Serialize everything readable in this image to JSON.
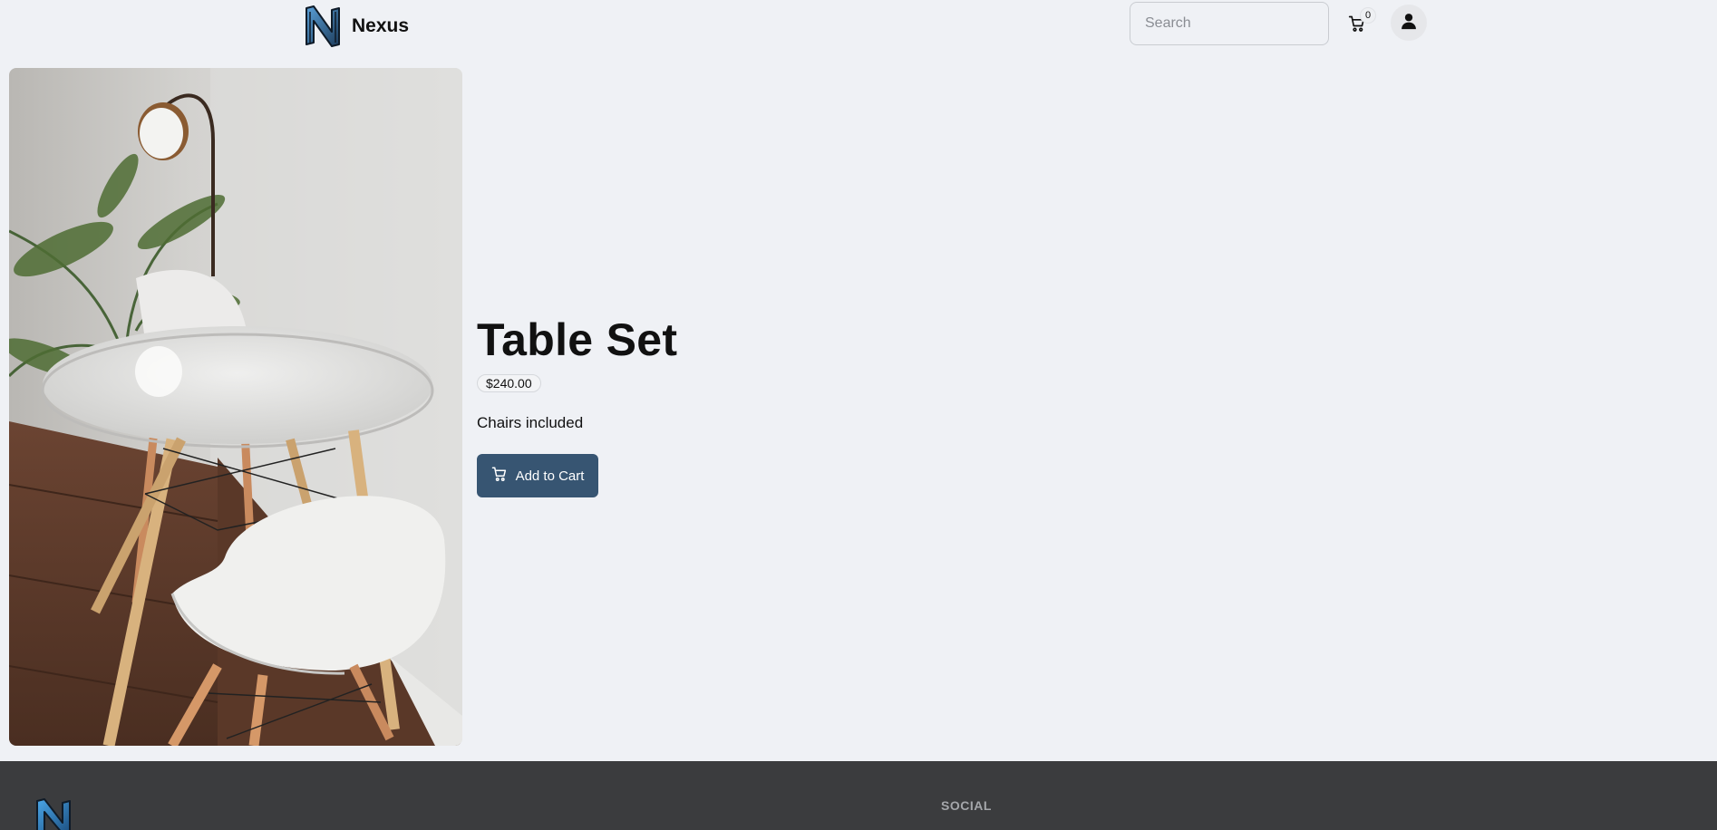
{
  "header": {
    "brand": "Nexus",
    "search_placeholder": "Search",
    "cart_count": "0"
  },
  "product": {
    "title": "Table Set",
    "price": "$240.00",
    "description": "Chairs included",
    "add_to_cart_label": "Add to Cart"
  },
  "footer": {
    "social_heading": "SOCIAL"
  },
  "icons": {
    "logo": "nexus-logo-icon",
    "cart": "cart-icon",
    "user": "user-icon"
  },
  "colors": {
    "accent": "#375572",
    "background": "#eff1f5",
    "footer": "#3b3c3e"
  }
}
